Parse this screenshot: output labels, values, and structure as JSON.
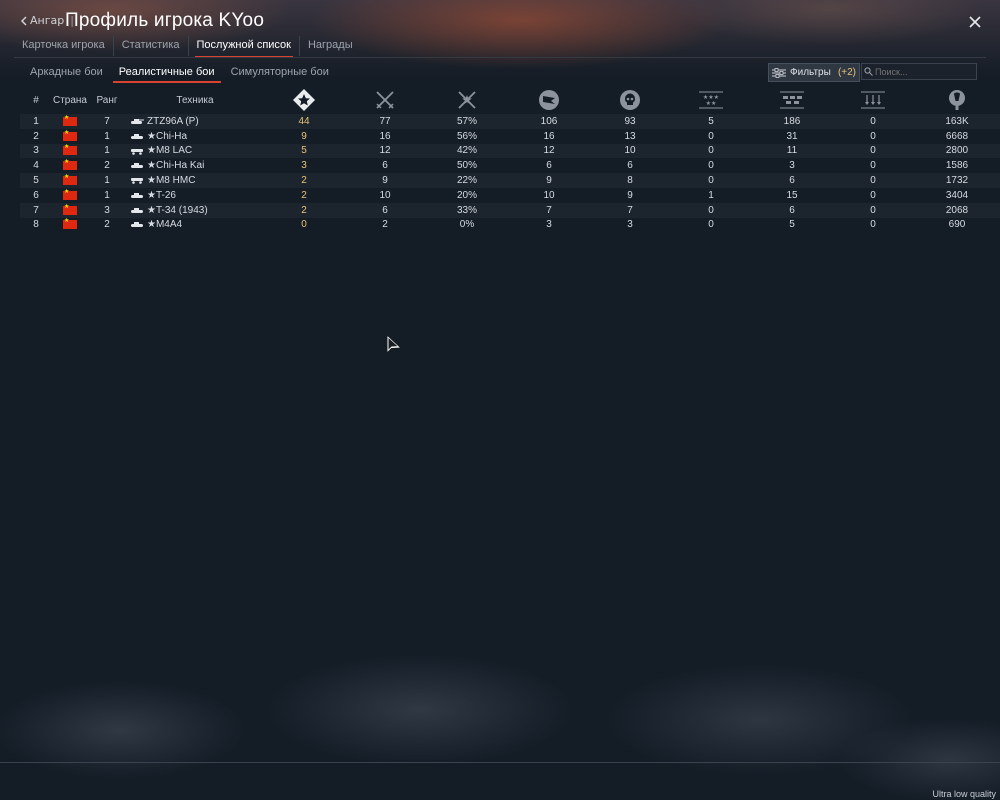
{
  "header": {
    "back_label": "Ангар",
    "back_sep": "|",
    "title": "Профиль игрока KYoo"
  },
  "main_tabs": [
    {
      "label": "Карточка игрока",
      "active": false
    },
    {
      "label": "Статистика",
      "active": false
    },
    {
      "label": "Послужной список",
      "active": true
    },
    {
      "label": "Награды",
      "active": false
    }
  ],
  "mode_tabs": [
    {
      "label": "Аркадные бои",
      "active": false
    },
    {
      "label": "Реалистичные бои",
      "active": true
    },
    {
      "label": "Симуляторные бои",
      "active": false
    }
  ],
  "filter": {
    "label": "Фильтры",
    "count": "(+2)"
  },
  "search": {
    "placeholder": "Поиск..."
  },
  "table": {
    "headers": {
      "num": "#",
      "country": "Страна",
      "rank": "Ранг",
      "vehicle": "Техника"
    },
    "icon_headers": [
      "victories-icon",
      "battles-icon",
      "win-rate-icon",
      "respawns-icon",
      "deaths-icon",
      "air-kills-icon",
      "ground-kills-icon",
      "naval-kills-icon",
      "activity-icon"
    ],
    "rows": [
      {
        "num": "1",
        "rank": "7",
        "name": "ZTZ96A (P)",
        "victories": "44",
        "battles": "77",
        "winrate": "57%",
        "respawns": "106",
        "deaths": "93",
        "air": "5",
        "ground": "186",
        "naval": "0",
        "activity": "163K"
      },
      {
        "num": "2",
        "rank": "1",
        "name": "Chi-Ha",
        "victories": "9",
        "battles": "16",
        "winrate": "56%",
        "respawns": "16",
        "deaths": "13",
        "air": "0",
        "ground": "31",
        "naval": "0",
        "activity": "6668"
      },
      {
        "num": "3",
        "rank": "1",
        "name": "M8 LAC",
        "victories": "5",
        "battles": "12",
        "winrate": "42%",
        "respawns": "12",
        "deaths": "10",
        "air": "0",
        "ground": "11",
        "naval": "0",
        "activity": "2800"
      },
      {
        "num": "4",
        "rank": "2",
        "name": "Chi-Ha Kai",
        "victories": "3",
        "battles": "6",
        "winrate": "50%",
        "respawns": "6",
        "deaths": "6",
        "air": "0",
        "ground": "3",
        "naval": "0",
        "activity": "1586"
      },
      {
        "num": "5",
        "rank": "1",
        "name": "M8 HMC",
        "victories": "2",
        "battles": "9",
        "winrate": "22%",
        "respawns": "9",
        "deaths": "8",
        "air": "0",
        "ground": "6",
        "naval": "0",
        "activity": "1732"
      },
      {
        "num": "6",
        "rank": "1",
        "name": "T-26",
        "victories": "2",
        "battles": "10",
        "winrate": "20%",
        "respawns": "10",
        "deaths": "9",
        "air": "1",
        "ground": "15",
        "naval": "0",
        "activity": "3404"
      },
      {
        "num": "7",
        "rank": "3",
        "name": "T-34 (1943)",
        "victories": "2",
        "battles": "6",
        "winrate": "33%",
        "respawns": "7",
        "deaths": "7",
        "air": "0",
        "ground": "6",
        "naval": "0",
        "activity": "2068"
      },
      {
        "num": "8",
        "rank": "2",
        "name": "M4A4",
        "victories": "0",
        "battles": "2",
        "winrate": "0%",
        "respawns": "3",
        "deaths": "3",
        "air": "0",
        "ground": "5",
        "naval": "0",
        "activity": "690"
      }
    ]
  },
  "footer": {
    "quality": "Ultra low quality"
  },
  "colors": {
    "accent": "#d9422e",
    "gold": "#e6c27a",
    "flag": "#de2910"
  }
}
